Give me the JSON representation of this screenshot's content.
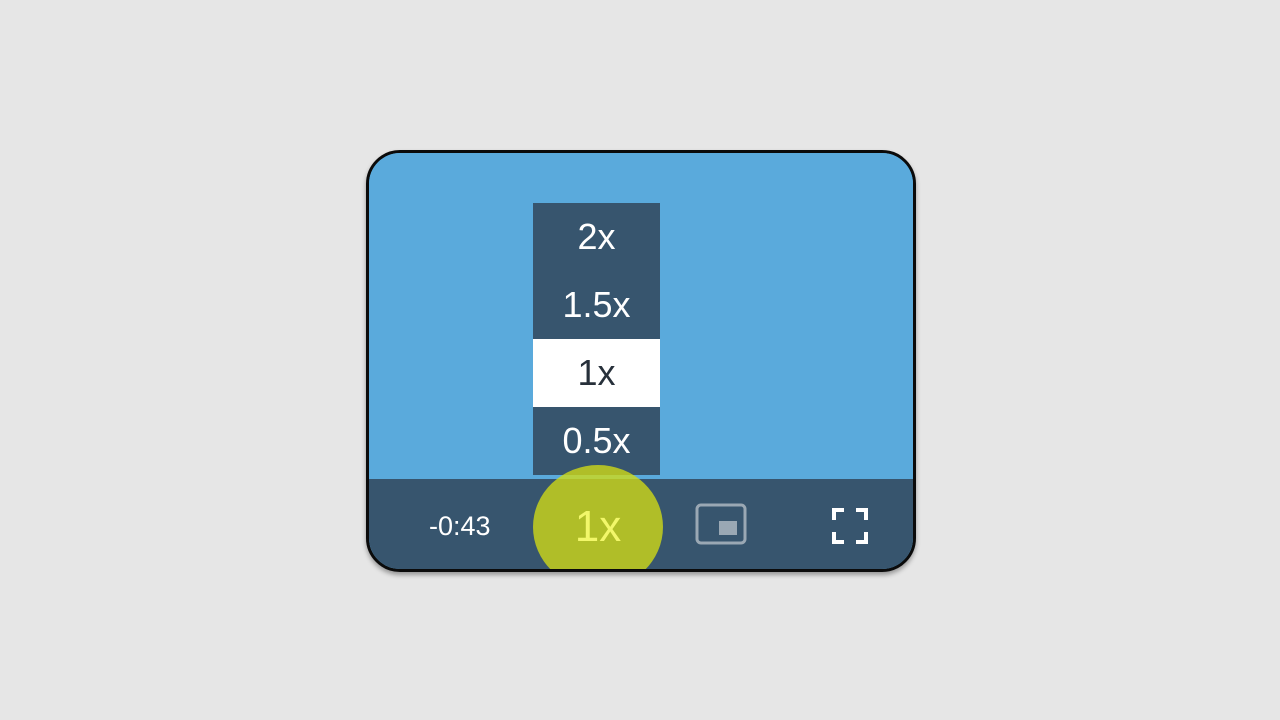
{
  "player": {
    "time_remaining": "-0:43",
    "speed_options": [
      "2x",
      "1.5x",
      "1x",
      "0.5x"
    ],
    "selected_speed": "1x",
    "speed_button_label": "1x",
    "icons": {
      "pip": "picture-in-picture-icon",
      "fullscreen": "fullscreen-icon"
    },
    "colors": {
      "video_background": "#5aaadc",
      "controls_background": "#37556e",
      "highlight": "#d2dc14",
      "speed_label": "#f2f76a"
    }
  }
}
